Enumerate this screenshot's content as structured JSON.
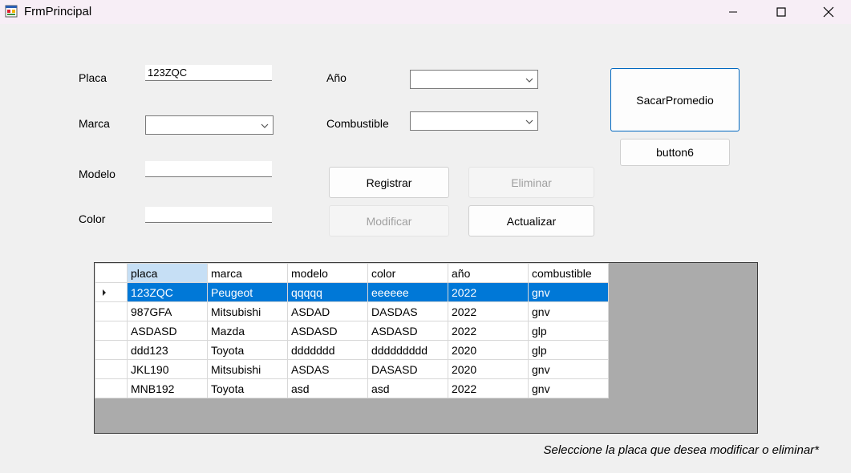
{
  "window": {
    "title": "FrmPrincipal"
  },
  "form": {
    "placa_label": "Placa",
    "placa_value": "123ZQC",
    "marca_label": "Marca",
    "modelo_label": "Modelo",
    "modelo_value": "",
    "color_label": "Color",
    "color_value": "",
    "anio_label": "Año",
    "combustible_label": "Combustible"
  },
  "buttons": {
    "registrar": "Registrar",
    "eliminar": "Eliminar",
    "modificar": "Modificar",
    "actualizar": "Actualizar",
    "sacar_promedio": "SacarPromedio",
    "button6": "button6"
  },
  "grid": {
    "columns": [
      "placa",
      "marca",
      "modelo",
      "color",
      "año",
      "combustible"
    ],
    "rows": [
      [
        "123ZQC",
        "Peugeot",
        "qqqqq",
        "eeeeee",
        "2022",
        "gnv"
      ],
      [
        "987GFA",
        "Mitsubishi",
        "ASDAD",
        "DASDAS",
        "2022",
        "gnv"
      ],
      [
        "ASDASD",
        "Mazda",
        "ASDASD",
        "ASDASD",
        "2022",
        "glp"
      ],
      [
        "ddd123",
        "Toyota",
        "ddddddd",
        "ddddddddd",
        "2020",
        "glp"
      ],
      [
        "JKL190",
        "Mitsubishi",
        "ASDAS",
        "DASASD",
        "2020",
        "gnv"
      ],
      [
        "MNB192",
        "Toyota",
        "asd",
        "asd",
        "2022",
        "gnv"
      ]
    ]
  },
  "hint": "Seleccione la placa que desea modificar o eliminar*",
  "colors": {
    "accent": "#0078d7",
    "grid_bg": "#ababab",
    "titlebar": "#f7eef6"
  }
}
